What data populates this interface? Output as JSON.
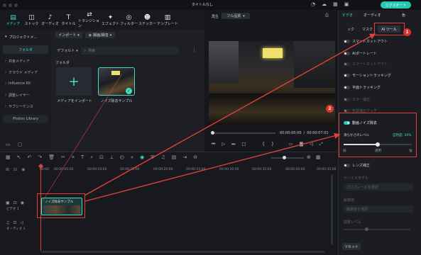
{
  "window": {
    "title": "タイトルなし",
    "export_label": "エクスポート"
  },
  "toolbar": {
    "items": [
      {
        "label": "メディア",
        "icon": "media-icon"
      },
      {
        "label": "ストック",
        "icon": "stock-icon"
      },
      {
        "label": "オーディオ",
        "icon": "audio-icon"
      },
      {
        "label": "タイトル",
        "icon": "title-icon"
      },
      {
        "label": "トランジション",
        "icon": "transition-icon"
      },
      {
        "label": "エフェクト",
        "icon": "effect-icon"
      },
      {
        "label": "フィルター",
        "icon": "filter-icon"
      },
      {
        "label": "ステッカー",
        "icon": "sticker-icon"
      },
      {
        "label": "テンプレート",
        "icon": "template-icon"
      }
    ]
  },
  "sidebar": {
    "project_media": "プロジェクトメ...",
    "folder": "フォルダ",
    "items": [
      "共有メディア",
      "クラウド メディア",
      "Influence Kit",
      "調整レイヤー",
      "サブシーケンス"
    ],
    "photo_library": "Photos Library"
  },
  "media": {
    "import_label": "インポート",
    "record_label": "録画/録音",
    "sort_label": "デフォルト",
    "search_placeholder": "検索",
    "folder_label": "フォルダ",
    "import_tile_label": "メディアをインポート",
    "sample_label": "ノイズ除去サンプル"
  },
  "preview": {
    "player_label": "再生",
    "quality": "フル品質",
    "current_time": "00:00:00:00",
    "separator": "/",
    "total_time": "00:00:07:01"
  },
  "inspector": {
    "tabs": [
      "ビデオ",
      "オーディオ",
      "色"
    ],
    "subtabs": [
      "ック",
      "マスク",
      "AI ツール"
    ],
    "rows": [
      {
        "label": "スマートカットアウト",
        "on": false,
        "dim": false
      },
      {
        "label": "AIポートレート",
        "on": false,
        "dim": false
      },
      {
        "label": "スマートカットアウト",
        "on": false,
        "dim": true
      },
      {
        "label": "モーショントラッキング",
        "on": false,
        "dim": false
      },
      {
        "label": "平面トラッキング",
        "on": false,
        "dim": false
      },
      {
        "label": "カラー補正",
        "on": false,
        "dim": true
      },
      {
        "label": "色調補正マッチ",
        "on": false,
        "dim": true
      }
    ],
    "denoise": {
      "label": "動画ノイズ除去",
      "on": true,
      "strength_label": "滑らかさのレベル",
      "strength_value": "自然度: 10%",
      "level": 0.5,
      "min": "弱",
      "mid": "適用",
      "max": "強"
    },
    "lens": {
      "label": "レンズ補正",
      "on": false
    },
    "camera_label": "デバイスモデル",
    "camera_value": "プロフィールを選択",
    "resolution_label": "解像度",
    "resolution_value": "解像度を選択",
    "adjust_label": "調整レベル",
    "reset_label": "リセット"
  },
  "timeline": {
    "ruler": [
      "00:00",
      "00:00:05:00",
      "00:00:10:00",
      "00:00:15:00",
      "00:00:20:00",
      "00:00:25:00",
      "00:00:30:00",
      "00:00:35:00",
      "00:00:40:00",
      "00:00:45:00"
    ],
    "video_track": "ビデオ 1",
    "audio_track": "オーディオ 1",
    "clip_label": "ノイズ除去サンプル"
  },
  "annotations": [
    "1",
    "2"
  ],
  "colors": {
    "accent": "#3fe0c8",
    "annotation": "#e0403a",
    "export": "#25c9b0"
  }
}
